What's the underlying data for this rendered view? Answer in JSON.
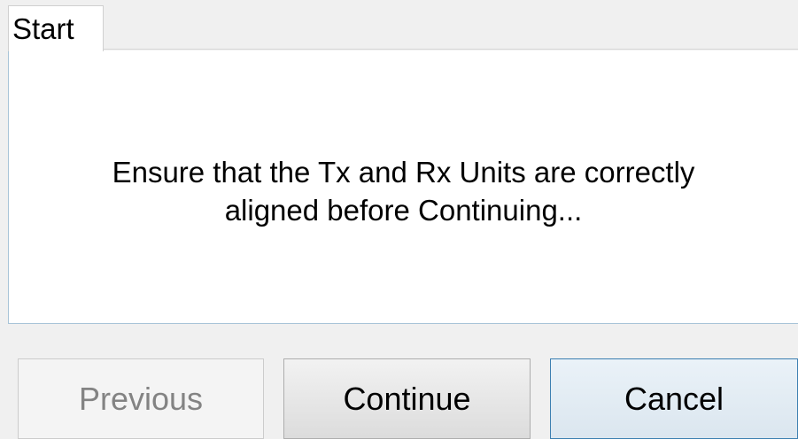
{
  "tabs": [
    {
      "label": "Start",
      "active": true
    }
  ],
  "message": {
    "line1": "Ensure that the Tx and Rx Units are correctly",
    "line2": "aligned before Continuing..."
  },
  "buttons": {
    "previous": {
      "label": "Previous",
      "enabled": false
    },
    "continue": {
      "label": "Continue",
      "enabled": true
    },
    "cancel": {
      "label": "Cancel",
      "enabled": true,
      "focused": true
    }
  },
  "colors": {
    "window_background": "#f0f0f0",
    "panel_background": "#ffffff",
    "panel_border": "#a8c4d8",
    "disabled_text": "#838383",
    "focus_border": "#3c7fb1"
  }
}
